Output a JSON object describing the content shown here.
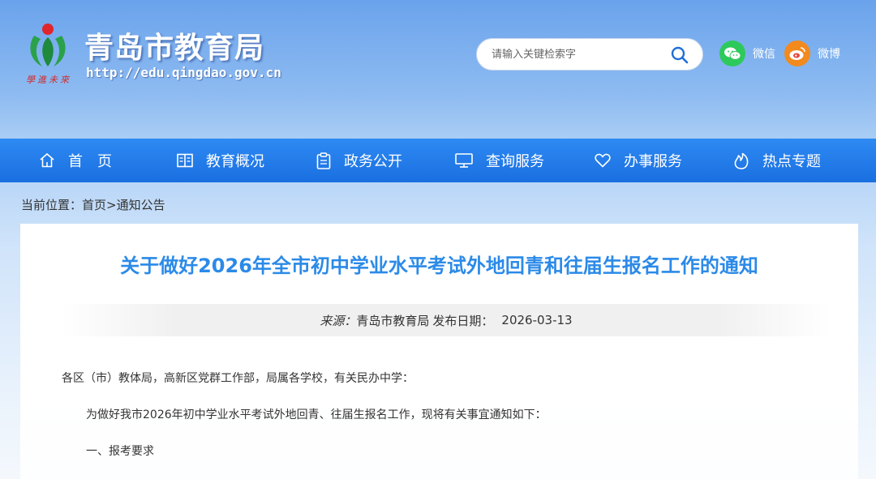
{
  "header": {
    "site_name": "青岛市教育局",
    "url_text": "http://edu.qingdao.gov.cn",
    "search_placeholder": "请输入关键检索字",
    "social": [
      {
        "label": "微信",
        "icon": "wechat-icon",
        "color": "#2ec95b"
      },
      {
        "label": "微博",
        "icon": "weibo-icon",
        "color": "#f28a1d"
      }
    ]
  },
  "nav": {
    "items": [
      {
        "label": "首页",
        "icon": "home-icon"
      },
      {
        "label": "教育概况",
        "icon": "book-icon"
      },
      {
        "label": "政务公开",
        "icon": "clipboard-icon"
      },
      {
        "label": "查询服务",
        "icon": "monitor-icon"
      },
      {
        "label": "办事服务",
        "icon": "heart-icon"
      },
      {
        "label": "热点专题",
        "icon": "flame-icon"
      }
    ],
    "bg_color": "#1f7ae8"
  },
  "breadcrumb": {
    "prefix": "当前位置：",
    "home": "首页",
    "sep": ">",
    "current": "通知公告"
  },
  "article": {
    "title": "关于做好2026年全市初中学业水平考试外地回青和往届生报名工作的通知",
    "source_label": "来源：",
    "source": "青岛市教育局",
    "date_label": "发布日期：",
    "date": "2026-03-13",
    "paragraphs": [
      "各区（市）教体局，高新区党群工作部，局属各学校，有关民办中学：",
      "为做好我市2026年初中学业水平考试外地回青、往届生报名工作，现将有关事宜通知如下：",
      "一、报考要求"
    ],
    "title_color": "#2b8ae8"
  }
}
